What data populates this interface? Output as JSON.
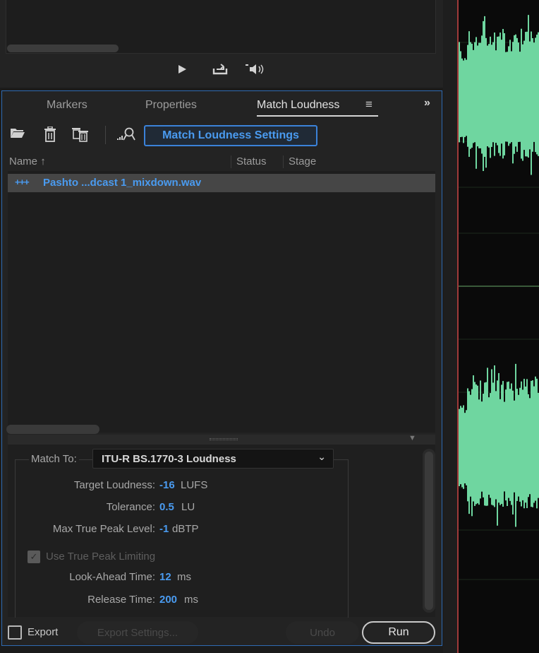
{
  "transport": {
    "icons": [
      "play-icon",
      "loop-icon",
      "output-speaker-icon"
    ]
  },
  "panel": {
    "tabs": [
      {
        "label": "Markers",
        "active": false
      },
      {
        "label": "Properties",
        "active": false
      },
      {
        "label": "Match Loudness",
        "active": true
      }
    ],
    "menu_glyph": "≡",
    "expand_glyph": "»",
    "toolbar": {
      "icons": [
        "open-folder-icon",
        "trash-icon",
        "trash-all-icon",
        "analyze-icon"
      ],
      "settings_button": "Match Loudness Settings"
    },
    "list": {
      "headers": [
        "Name",
        "Status",
        "Stage"
      ],
      "sort_icon": "↑",
      "files": [
        {
          "name": "Pashto ...dcast 1_mixdown.wav",
          "icon": "audio-file-icon",
          "status": "",
          "stage": ""
        }
      ]
    },
    "settings": {
      "match_to_label": "Match To:",
      "match_to_value": "ITU-R BS.1770-3 Loudness",
      "target_loudness": {
        "label": "Target Loudness:",
        "value": "-16",
        "unit": "LUFS"
      },
      "tolerance": {
        "label": "Tolerance:",
        "value": "0.5",
        "unit": "LU"
      },
      "max_true_peak": {
        "label": "Max True Peak Level:",
        "value": "-1",
        "unit": "dBTP"
      },
      "use_true_peak_limiting": {
        "label": "Use True Peak Limiting",
        "checked": true,
        "enabled": false
      },
      "look_ahead": {
        "label": "Look-Ahead Time:",
        "value": "12",
        "unit": "ms"
      },
      "release": {
        "label": "Release Time:",
        "value": "200",
        "unit": "ms"
      }
    },
    "footer": {
      "export_label": "Export",
      "export_checked": false,
      "export_settings_label": "Export Settings...",
      "undo_label": "Undo",
      "run_label": "Run"
    }
  },
  "colors": {
    "accent": "#4a9bf0",
    "waveform": "#6fd6a0",
    "panel_border": "#2f6bb3"
  }
}
